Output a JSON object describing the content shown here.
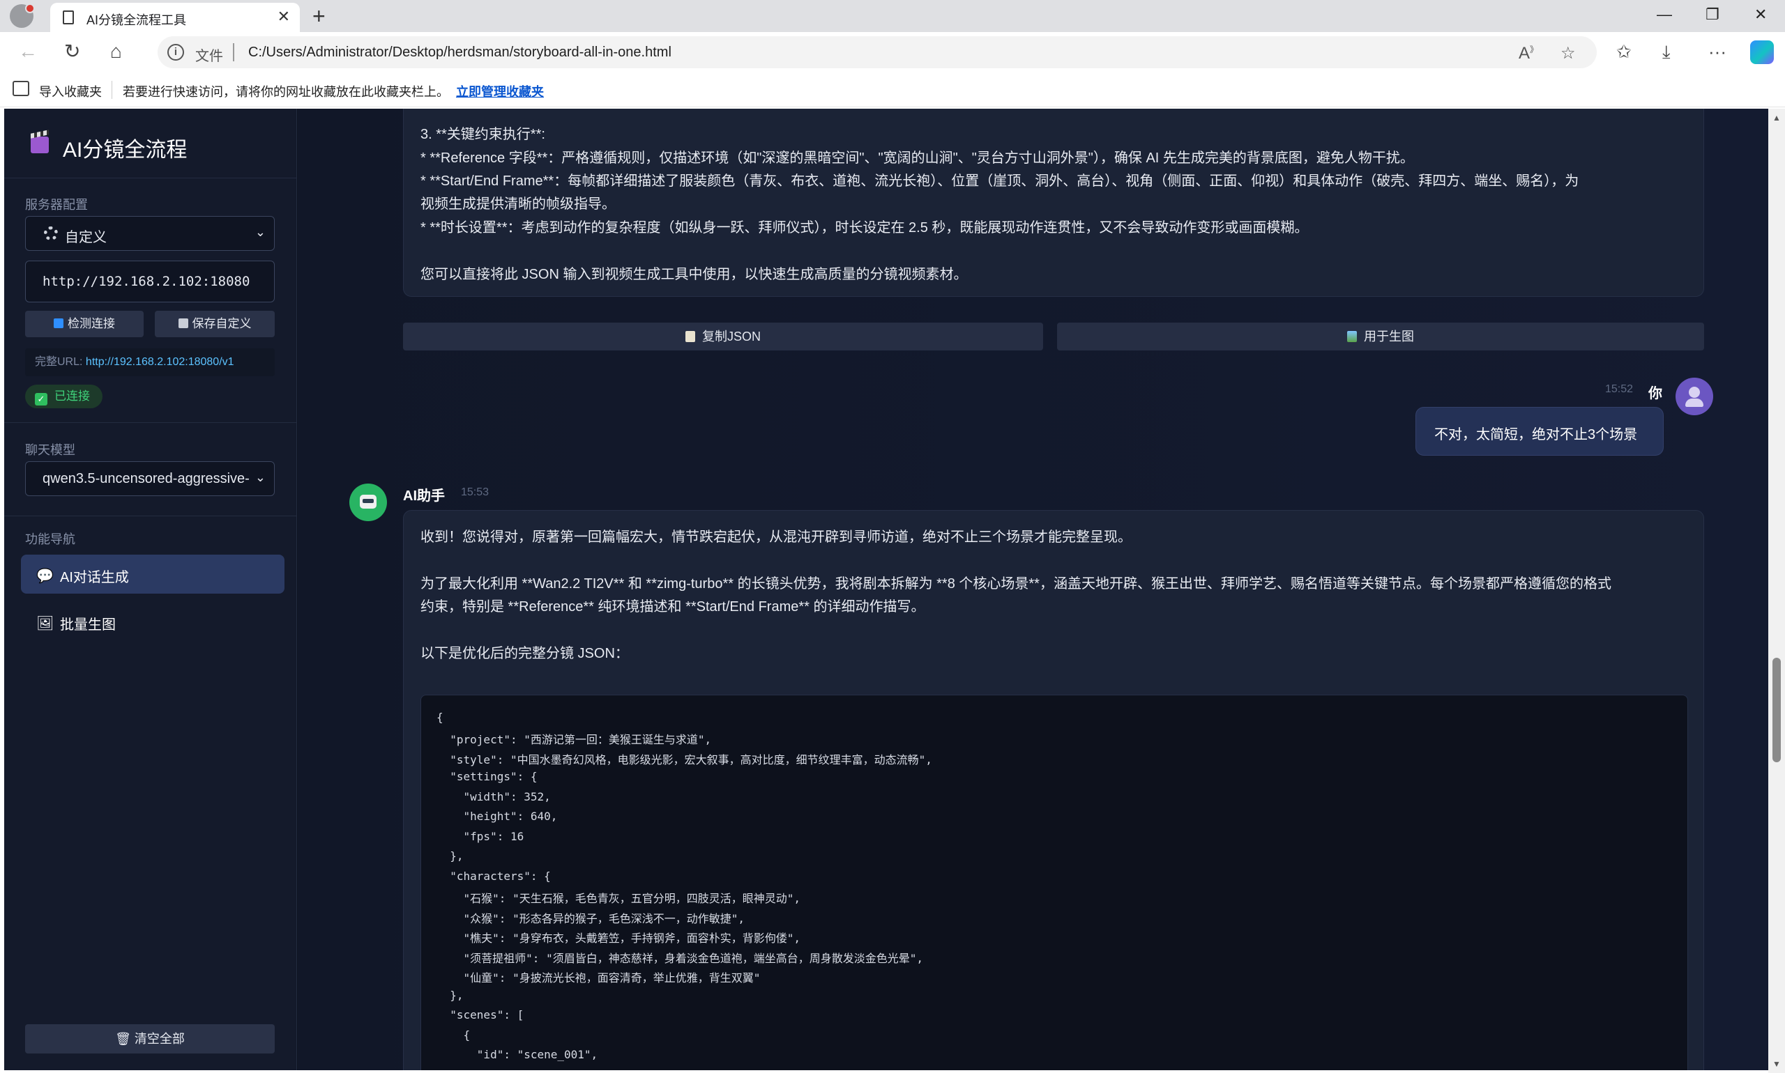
{
  "browser": {
    "tab_title": "AI分镜全流程工具",
    "tab_close": "✕",
    "new_tab": "+",
    "address_scheme": "文件",
    "address_url": "C:/Users/Administrator/Desktop/herdsman/storyboard-all-in-one.html",
    "favorites_import": "导入收藏夹",
    "favorites_hint": "若要进行快速访问，请将你的网址收藏放在此收藏夹栏上。",
    "favorites_link": "立即管理收藏夹"
  },
  "sidebar": {
    "title": "AI分镜全流程",
    "server_section": "服务器配置",
    "server_preset": "自定义",
    "server_url": "http://192.168.2.102:18080",
    "btn_check": "检测连接",
    "btn_save": "保存自定义",
    "full_url_label": "完整URL:",
    "full_url_value": "http://192.168.2.102:18080/v1",
    "status": "已连接",
    "model_section": "聊天模型",
    "model_value": "qwen3.5-uncensored-aggressive-",
    "nav_section": "功能导航",
    "nav_items": [
      {
        "label": "AI对话生成",
        "icon": "💬"
      },
      {
        "label": "批量生图",
        "icon": "🖼"
      }
    ],
    "clear_all": "清空全部"
  },
  "chat": {
    "prev_message": [
      "3.  **关键约束执行**:",
      "    *  **Reference 字段**：严格遵循规则，仅描述环境（如\"深邃的黑暗空间\"、\"宽阔的山涧\"、\"灵台方寸山洞外景\"），确保 AI 先生成完美的背景底图，避免人物干扰。",
      "    *  **Start/End Frame**：每帧都详细描述了服装颜色（青灰、布衣、道袍、流光长袍）、位置（崖顶、洞外、高台）、视角（侧面、正面、仰视）和具体动作（破壳、拜四方、端坐、赐名），为",
      "视频生成提供清晰的帧级指导。",
      "    *  **时长设置**：考虑到动作的复杂程度（如纵身一跃、拜师仪式），时长设定在 2.5 秒，既能展现动作连贯性，又不会导致动作变形或画面模糊。",
      "",
      "您可以直接将此 JSON 输入到视频生成工具中使用，以快速生成高质量的分镜视频素材。"
    ],
    "btn_copy_json": "复制JSON",
    "btn_use_image": "用于生图",
    "user_time": "15:52",
    "user_name": "你",
    "user_message": "不对，太简短，绝对不止3个场景",
    "ai_name": "AI助手",
    "ai_time": "15:53",
    "ai_paragraphs": [
      "收到！您说得对，原著第一回篇幅宏大，情节跌宕起伏，从混沌开辟到寻师访道，绝对不止三个场景才能完整呈现。",
      "为了最大化利用 **Wan2.2 TI2V** 和 **zimg-turbo** 的长镜头优势，我将剧本拆解为 **8 个核心场景**，涵盖天地开辟、猴王出世、拜师学艺、赐名悟道等关键节点。每个场景都严格遵循您的格式",
      "约束，特别是 **Reference** 纯环境描述和 **Start/End Frame** 的详细动作描写。",
      "以下是优化后的完整分镜 JSON："
    ],
    "code_lines": [
      "{",
      "  \"project\": \"西游记第一回：美猴王诞生与求道\",",
      "  \"style\": \"中国水墨奇幻风格，电影级光影，宏大叙事，高对比度，细节纹理丰富，动态流畅\",",
      "  \"settings\": {",
      "    \"width\": 352,",
      "    \"height\": 640,",
      "    \"fps\": 16",
      "  },",
      "  \"characters\": {",
      "    \"石猴\": \"天生石猴，毛色青灰，五官分明，四肢灵活，眼神灵动\",",
      "    \"众猴\": \"形态各异的猴子，毛色深浅不一，动作敏捷\",",
      "    \"樵夫\": \"身穿布衣，头戴箬笠，手持钢斧，面容朴实，背影佝偻\",",
      "    \"须菩提祖师\": \"须眉皆白，神态慈祥，身着淡金色道袍，端坐高台，周身散发淡金色光晕\",",
      "    \"仙童\": \"身披流光长袍，面容清奇，举止优雅，背生双翼\"",
      "  },",
      "  \"scenes\": [",
      "    {",
      "      \"id\": \"scene_001\","
    ]
  },
  "colors": {
    "accent": "#2b3a63",
    "status_ok": "#3fd27b",
    "link": "#5cc2ff"
  }
}
